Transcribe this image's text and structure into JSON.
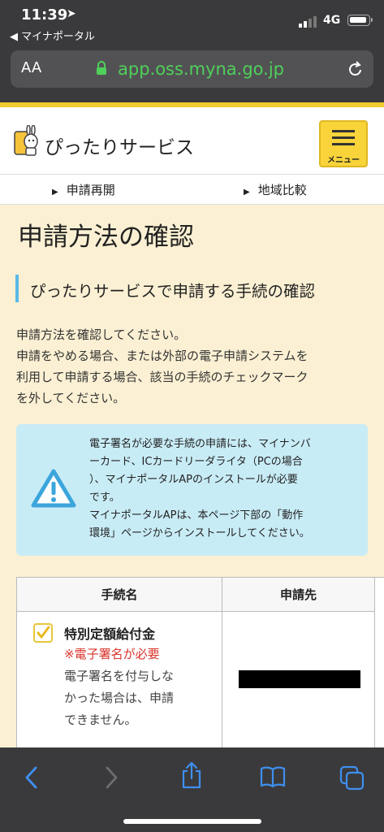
{
  "status": {
    "time": "11:39",
    "back_app": "◀ マイナポータル",
    "network": "4G"
  },
  "browser": {
    "text_size_label": "AA",
    "url": "app.oss.myna.go.jp"
  },
  "header": {
    "brand": "ぴったりサービス",
    "menu_label": "メニュー"
  },
  "subnav": {
    "items": [
      "申請再開",
      "地域比較"
    ]
  },
  "main": {
    "title": "申請方法の確認",
    "section_title": "ぴったりサービスで申請する手続の確認",
    "intro": [
      "申請方法を確認してください。",
      "申請をやめる場合、または外部の電子申請システムを",
      "利用して申請する場合、該当の手続のチェックマーク",
      "を外してください。"
    ],
    "notice": [
      "電子署名が必要な手続の申請には、マイナンバ",
      "ーカード、ICカードリーダライタ（PCの場合",
      "）、マイナポータルAPのインストールが必要",
      "です。",
      "マイナポータルAPは、本ページ下部の「動作",
      "環境」ページからインストールしてください。"
    ]
  },
  "table": {
    "headers": [
      "手続名",
      "申請先"
    ],
    "rows": [
      {
        "name": "特別定額給付金",
        "checked": true,
        "signature_required": "※電子署名が必要",
        "description": [
          "電子署名を付与しな",
          "かった場合は、申請",
          "できません。"
        ]
      }
    ]
  },
  "colors": {
    "accent_yellow": "#f8d43a",
    "notice_bg": "#c8ecf6",
    "section_bar": "#5bb8e6",
    "url_green": "#4fd05a",
    "warning_red": "#d9342b",
    "toolbar_blue": "#3f8ff0"
  },
  "icons": [
    "location-arrow-icon",
    "lock-icon",
    "reload-icon",
    "warning-icon",
    "checkmark-icon",
    "back-icon",
    "forward-icon",
    "share-icon",
    "bookmarks-icon",
    "tabs-icon"
  ]
}
